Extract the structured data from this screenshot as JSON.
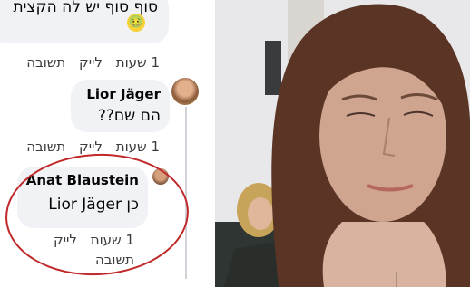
{
  "comments": [
    {
      "text": "סוף סוף יש לה הקצית",
      "emoji": "🤢",
      "time": "1 שעות",
      "like": "לייק",
      "reply": "תשובה"
    },
    {
      "author": "Lior Jäger",
      "text": "הם שם??",
      "time": "1 שעות",
      "like": "לייק",
      "reply": "תשובה"
    },
    {
      "author": "Anat Blaustein",
      "text_prefix": "כן",
      "mention": "Lior Jäger",
      "time": "1 שעות",
      "like": "לייק",
      "reply": "תשובה"
    }
  ],
  "colors": {
    "bubble": "#f0f2f5",
    "highlight_circle": "#c0282a",
    "text": "#050505",
    "meta_text": "#3a3b3c"
  }
}
